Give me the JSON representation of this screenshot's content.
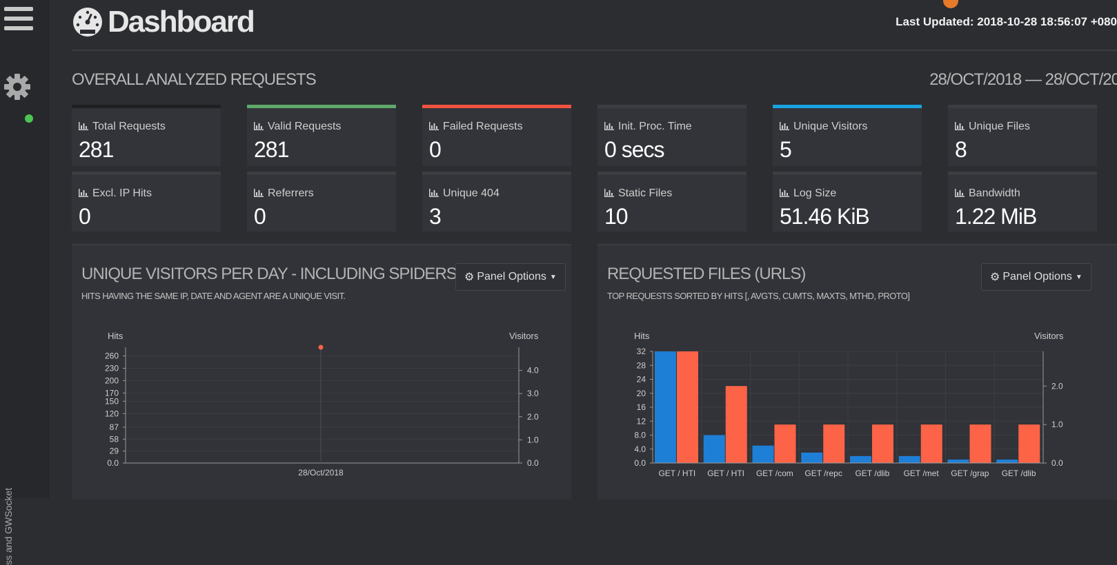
{
  "header": {
    "title": "Dashboard",
    "last_updated_label": "Last Updated:",
    "last_updated_value": "2018-10-28 18:56:07 +080"
  },
  "sidebar": {
    "vertical_text": "ss and GWSocket",
    "status_color": "#4cc552"
  },
  "overall": {
    "title": "OVERALL ANALYZED REQUESTS",
    "date_range": "28/OCT/2018 — 28/OCT/20"
  },
  "cards": [
    {
      "label": "Total Requests",
      "value": "281",
      "accent": "#1f2023"
    },
    {
      "label": "Valid Requests",
      "value": "281",
      "accent": "#5fa86a"
    },
    {
      "label": "Failed Requests",
      "value": "0",
      "accent": "#f0533f"
    },
    {
      "label": "Init. Proc. Time",
      "value": "0 secs",
      "accent": "#3b3d42"
    },
    {
      "label": "Unique Visitors",
      "value": "5",
      "accent": "#1aa3e0"
    },
    {
      "label": "Unique Files",
      "value": "8",
      "accent": "#3b3d42"
    },
    {
      "label": "Excl. IP Hits",
      "value": "0",
      "accent": "#3b3d42"
    },
    {
      "label": "Referrers",
      "value": "0",
      "accent": "#3b3d42"
    },
    {
      "label": "Unique 404",
      "value": "3",
      "accent": "#3b3d42"
    },
    {
      "label": "Static Files",
      "value": "10",
      "accent": "#3b3d42"
    },
    {
      "label": "Log Size",
      "value": "51.46 KiB",
      "accent": "#3b3d42"
    },
    {
      "label": "Bandwidth",
      "value": "1.22 MiB",
      "accent": "#3b3d42"
    }
  ],
  "panels": {
    "visitors": {
      "title": "UNIQUE VISITORS PER DAY - INCLUDING SPIDERS",
      "subtitle": "HITS HAVING THE SAME IP, DATE AND AGENT ARE A UNIQUE VISIT.",
      "options_label": "Panel Options"
    },
    "files": {
      "title": "REQUESTED FILES (URLS)",
      "subtitle": "TOP REQUESTS SORTED BY HITS [, AVGTS, CUMTS, MAXTS, MTHD, PROTO]",
      "options_label": "Panel Options"
    }
  },
  "colors": {
    "hits": "#1e7fd6",
    "visitors": "#fd6347"
  },
  "chart_data": [
    {
      "type": "line",
      "ylabel": "Hits",
      "y2label": "Visitors",
      "categories": [
        "28/Oct/2018"
      ],
      "y_ticks": [
        "0.0",
        "29",
        "58",
        "87",
        "120",
        "150",
        "170",
        "200",
        "230",
        "260"
      ],
      "y2_ticks": [
        "0.0",
        "1.0",
        "2.0",
        "3.0",
        "4.0"
      ],
      "ylim": [
        0,
        281
      ],
      "y2lim": [
        0,
        5
      ],
      "series": [
        {
          "name": "Hits",
          "values": [
            281
          ],
          "axis": "left"
        },
        {
          "name": "Visitors",
          "values": [
            5
          ],
          "axis": "right"
        }
      ]
    },
    {
      "type": "bar",
      "ylabel": "Hits",
      "y2label": "Visitors",
      "categories": [
        "GET / HTI",
        "GET / HTI",
        "GET /com",
        "GET /repc",
        "GET /dlib",
        "GET /met",
        "GET /grap",
        "GET /dlib"
      ],
      "y_ticks": [
        "0.0",
        "4.0",
        "8.0",
        "12",
        "16",
        "20",
        "24",
        "28",
        "32"
      ],
      "y2_ticks": [
        "0.0",
        "1.0",
        "2.0"
      ],
      "ylim": [
        0,
        32
      ],
      "y2lim": [
        0,
        2.9
      ],
      "series": [
        {
          "name": "Hits",
          "axis": "left",
          "values": [
            32,
            8,
            5,
            3,
            2,
            2,
            1,
            1
          ]
        },
        {
          "name": "Visitors",
          "axis": "right",
          "values": [
            2.9,
            2.0,
            1.0,
            1.0,
            1.0,
            1.0,
            1.0,
            1.0
          ]
        }
      ]
    }
  ]
}
